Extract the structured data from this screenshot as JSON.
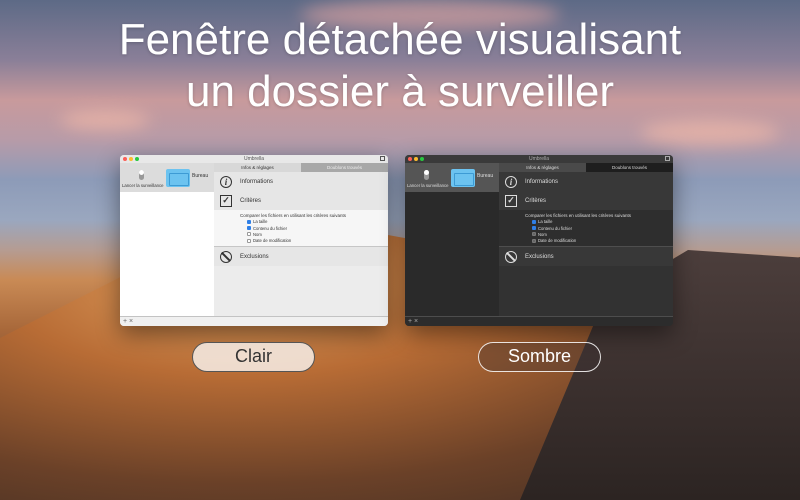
{
  "headline": {
    "line1": "Fenêtre détachée visualisant",
    "line2": "un dossier à surveiller"
  },
  "window": {
    "title": "Umbrella",
    "source_label": "Lancer la surveillance",
    "folder_name": "Bureau",
    "tabs": [
      "Infos & réglages",
      "Doublons trouvés"
    ],
    "sections": {
      "info": "Informations",
      "criteria": "Critères",
      "exclusions": "Exclusions"
    },
    "criteria_prompt": "Comparer les fichiers en utilisant les critères suivants",
    "criteria_options": [
      {
        "label": "La taille",
        "checked": true
      },
      {
        "label": "Contenu du fichier",
        "checked": true
      },
      {
        "label": "Nom",
        "checked": false
      },
      {
        "label": "Date de modification",
        "checked": false
      }
    ],
    "add_label": "+",
    "remove_label": "×"
  },
  "buttons": {
    "light": "Clair",
    "dark": "Sombre"
  }
}
